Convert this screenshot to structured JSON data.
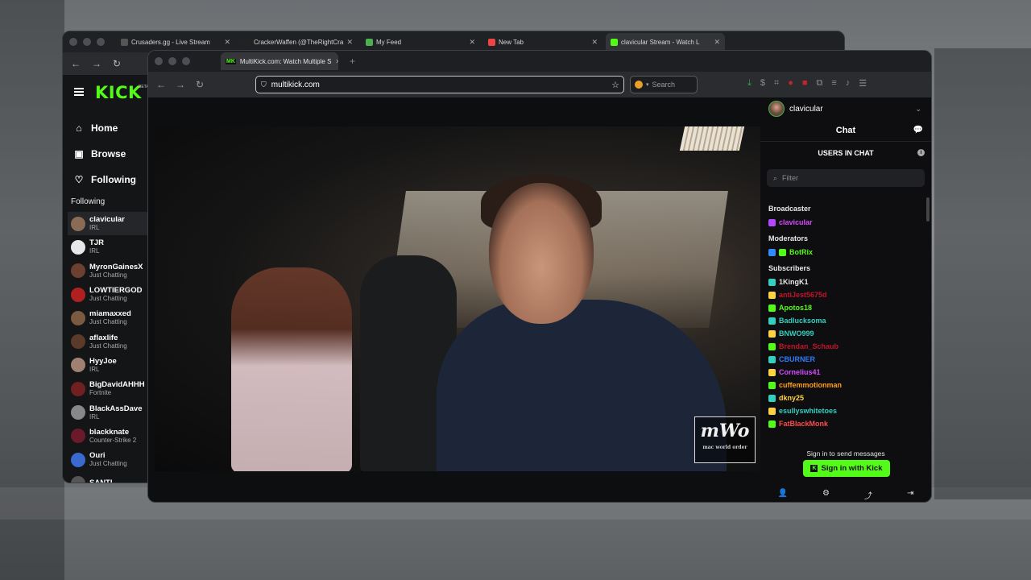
{
  "back_window": {
    "tabs": [
      {
        "label": "Crusaders.gg - Live Stream",
        "color": "#cfcfcf"
      },
      {
        "label": "CrackerWaffen (@TheRightCra",
        "color": "#cfcfcf"
      },
      {
        "label": "My Feed",
        "color": "#cfcfcf"
      },
      {
        "label": "New Tab",
        "color": "#cfcfcf"
      },
      {
        "label": "clavicular Stream - Watch L",
        "color": "#cfcfcf"
      }
    ],
    "logo": "KICK",
    "logo_beta": "BETA",
    "nav": [
      {
        "label": "Home",
        "icon": "home-icon"
      },
      {
        "label": "Browse",
        "icon": "browse-icon"
      },
      {
        "label": "Following",
        "icon": "heart-icon"
      }
    ],
    "following_heading": "Following",
    "following": [
      {
        "name": "clavicular",
        "category": "IRL",
        "avatar": "#8a6b55"
      },
      {
        "name": "TJR",
        "category": "IRL",
        "avatar": "#e8e8e8"
      },
      {
        "name": "MyronGainesX",
        "category": "Just Chatting",
        "avatar": "#6b4030"
      },
      {
        "name": "LOWTIERGOD",
        "category": "Just Chatting",
        "avatar": "#b02020"
      },
      {
        "name": "miamaxxed",
        "category": "Just Chatting",
        "avatar": "#7a5a40"
      },
      {
        "name": "aflaxlife",
        "category": "Just Chatting",
        "avatar": "#5a3a28"
      },
      {
        "name": "HyyJoe",
        "category": "IRL",
        "avatar": "#a08070"
      },
      {
        "name": "BigDavidAHHH",
        "category": "Fortnite",
        "avatar": "#702020"
      },
      {
        "name": "BlackAssDave",
        "category": "IRL",
        "avatar": "#888888"
      },
      {
        "name": "blackknate",
        "category": "Counter-Strike 2",
        "avatar": "#6a1a2a"
      },
      {
        "name": "Ouri",
        "category": "Just Chatting",
        "avatar": "#3a6ad0"
      },
      {
        "name": "SANTI",
        "category": "",
        "avatar": "#555555"
      }
    ]
  },
  "front_window": {
    "tab_label": "MultiKick.com: Watch Multiple S",
    "tab_icon_text": "MK",
    "url": "multikick.com",
    "search_placeholder": "Search",
    "watermark": {
      "big": "mWo",
      "small": "mac world order"
    },
    "chat": {
      "username": "clavicular",
      "title": "Chat",
      "users_in_chat": "USERS IN CHAT",
      "filter_placeholder": "Filter",
      "broadcaster_heading": "Broadcaster",
      "broadcaster": {
        "name": "clavicular",
        "color": "#d44aff"
      },
      "moderators_heading": "Moderators",
      "moderators": [
        {
          "name": "BotRix",
          "color": "#53fc18"
        }
      ],
      "subscribers_heading": "Subscribers",
      "subscribers": [
        {
          "name": "1KingK1",
          "color": "#e8e8e8"
        },
        {
          "name": "antiJest5675d",
          "color": "#c0152c"
        },
        {
          "name": "Apotos18",
          "color": "#53fc18"
        },
        {
          "name": "Badlucksoma",
          "color": "#31d0c0"
        },
        {
          "name": "BNWO999",
          "color": "#31d0c0"
        },
        {
          "name": "Brendan_Schaub",
          "color": "#c0152c"
        },
        {
          "name": "CBURNER",
          "color": "#2f7bff"
        },
        {
          "name": "Cornelius41",
          "color": "#d44aff"
        },
        {
          "name": "cuffemmotionman",
          "color": "#ff9f1a"
        },
        {
          "name": "dkny25",
          "color": "#ffd23f"
        },
        {
          "name": "esullyswhitetoes",
          "color": "#31d0c0"
        },
        {
          "name": "FatBlackMonk",
          "color": "#ff4b4b"
        }
      ],
      "signin_prompt": "Sign in to send messages",
      "signin_button": "Sign in with Kick"
    }
  }
}
